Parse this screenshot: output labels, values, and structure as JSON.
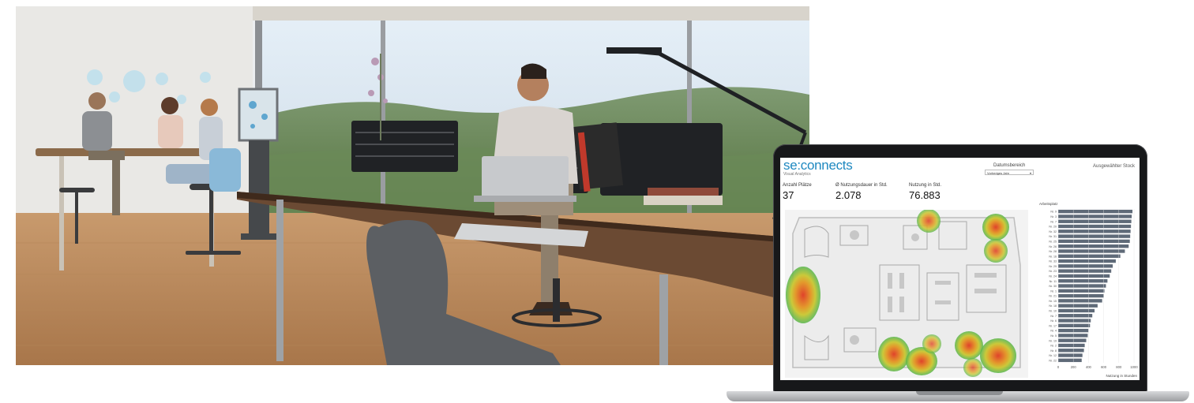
{
  "dashboard": {
    "brand": {
      "name": "se:connects",
      "subtitle": "Visual Analytics"
    },
    "date_range": {
      "label": "Datumsbereich",
      "value": "Vorheriges Jahr"
    },
    "floor": {
      "label": "Ausgewählter Stock"
    },
    "kpis": [
      {
        "label": "Anzahl Plätze",
        "value": "37"
      },
      {
        "label": "Ø Nutzungsdauer in Std.",
        "value": "2.078"
      },
      {
        "label": "Nutzung in Std.",
        "value": "76.883"
      }
    ],
    "colors": {
      "brand": "#1e88c0",
      "bar": "#5f6a78"
    }
  },
  "chart_data": {
    "type": "bar",
    "orientation": "horizontal",
    "title": "Arbeitsplatz",
    "xlabel": "Nutzung in Stunden",
    "xlim": [
      0,
      1000
    ],
    "xticks": [
      "0",
      "200",
      "400",
      "600",
      "800",
      "1000"
    ],
    "categories": [
      "Nr. 9",
      "Nr. 3",
      "Nr. 7",
      "Nr. 20",
      "Nr. 32",
      "Nr. 31",
      "Nr. 25",
      "Nr. 26",
      "Nr. 28",
      "Nr. 16",
      "Nr. 33",
      "Nr. 29",
      "Nr. 23",
      "Nr. 24",
      "Nr. 11",
      "Nr. 30",
      "Nr. 1",
      "Nr. 21",
      "Nr. 15",
      "Nr. 18",
      "Nr. 10",
      "Nr. 7",
      "Nr. 6",
      "Nr. 17",
      "Nr. 4",
      "Nr. 5",
      "Nr. 19",
      "Nr. 2",
      "Nr. 8",
      "Nr. 12",
      "Nr. 22"
    ],
    "values": [
      980,
      970,
      965,
      960,
      955,
      950,
      945,
      930,
      880,
      820,
      760,
      720,
      700,
      680,
      650,
      630,
      610,
      600,
      580,
      520,
      480,
      450,
      430,
      420,
      400,
      390,
      370,
      350,
      340,
      320,
      310
    ]
  }
}
